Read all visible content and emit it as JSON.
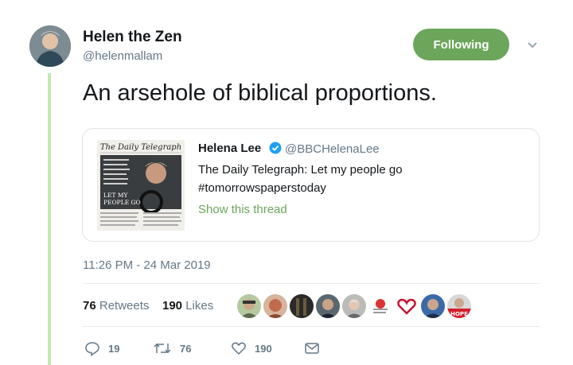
{
  "author": {
    "name": "Helen the Zen",
    "handle": "@helenmallam",
    "follow_label": "Following"
  },
  "tweet_text": "An arsehole of biblical proportions.",
  "quoted": {
    "name": "Helena Lee",
    "handle": "@BBCHelenaLee",
    "line1": "The Daily Telegraph: Let my people go",
    "line2": "#tomorrowspaperstoday",
    "show_thread": "Show this thread",
    "image": {
      "masthead": "The Daily Telegraph",
      "headline_line1": "LET MY",
      "headline_line2": "PEOPLE GO"
    }
  },
  "timestamp": "11:26 PM - 24 Mar 2019",
  "stats": {
    "retweets_count": "76",
    "retweets_label": "Retweets",
    "likes_count": "190",
    "likes_label": "Likes",
    "liker_badge_text": "HOPE"
  },
  "actions": {
    "reply_count": "19",
    "retweet_count": "76",
    "like_count": "190"
  },
  "icons": {
    "reply": "reply-icon",
    "retweet": "retweet-icon",
    "like": "heart-icon",
    "dm": "envelope-icon",
    "caret": "chevron-down-icon",
    "verified": "verified-badge-icon"
  },
  "colors": {
    "accent": "#6ca65b",
    "thread_line": "#c5e8b0",
    "secondary_text": "#657786",
    "verified": "#1da1f2"
  }
}
